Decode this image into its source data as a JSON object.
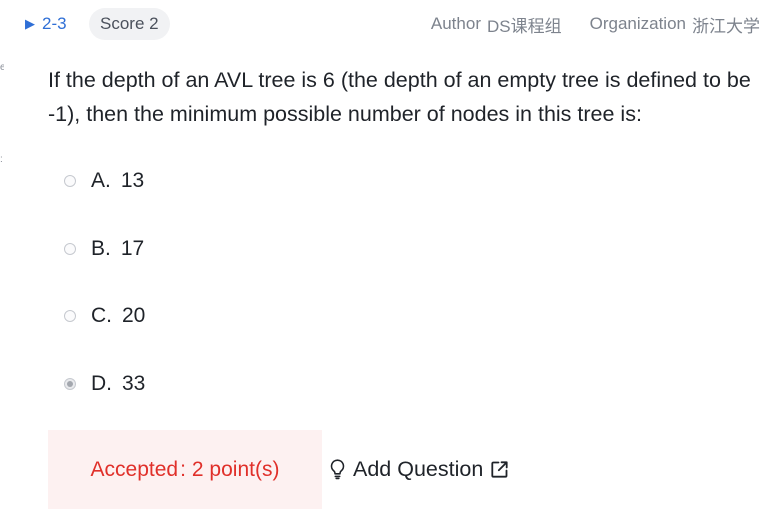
{
  "header": {
    "question_number": "2-3",
    "expand_icon": "caret-right-icon",
    "score_label": "Score 2",
    "author_label": "Author",
    "author_value": "DS课程组",
    "organization_label": "Organization",
    "organization_value": "浙江大学"
  },
  "question": {
    "stem": "If the depth of an AVL tree is 6 (the depth of an empty tree is defined to be -1), then the minimum possible number of nodes in this tree is:",
    "options": [
      {
        "letter": "A.",
        "text": "13",
        "selected": false
      },
      {
        "letter": "B.",
        "text": "17",
        "selected": false
      },
      {
        "letter": "C.",
        "text": "20",
        "selected": false
      },
      {
        "letter": "D.",
        "text": "33",
        "selected": true
      }
    ]
  },
  "result": {
    "status": "Accepted",
    "separator": ":",
    "points": "2 point(s)"
  },
  "actions": {
    "add_question_label": "Add Question",
    "add_question_icon": "lightbulb-icon",
    "external_icon": "external-link-icon"
  },
  "colors": {
    "accent": "#2f6fd6",
    "accepted": "#e0302a",
    "accepted_bg": "#fdf1f1"
  }
}
